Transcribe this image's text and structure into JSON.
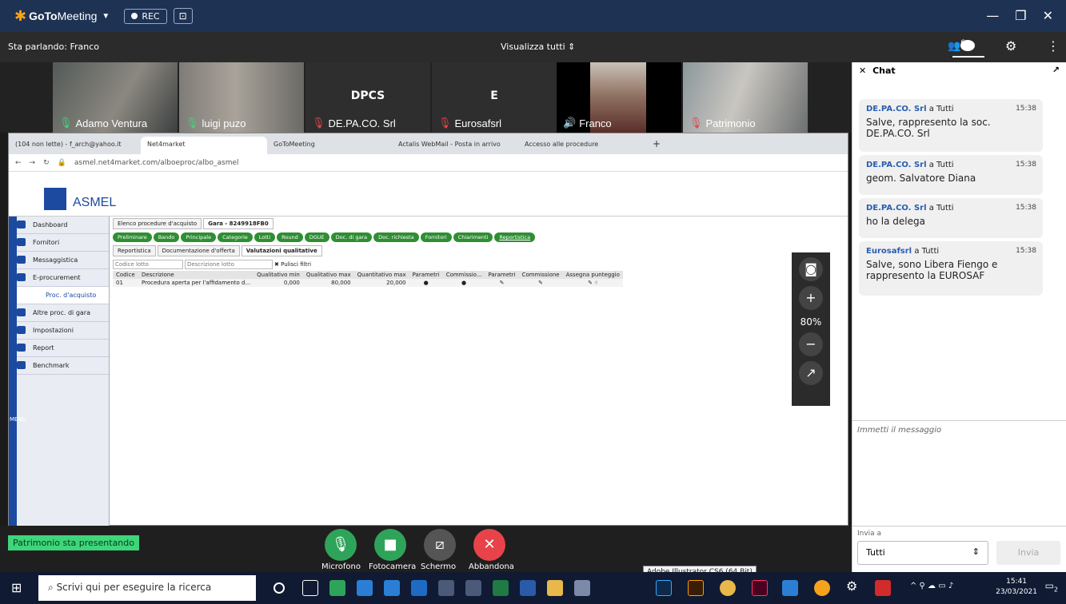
{
  "app": {
    "brand_go": "GoTo",
    "brand_rest": "Meeting",
    "rec_label": "REC",
    "speaking": "Sta parlando: Franco",
    "view_all": "Visualizza tutti",
    "attendee_count": "6"
  },
  "participants": [
    {
      "name": "Adamo Ventura",
      "mic": "on"
    },
    {
      "name": "luigi puzo",
      "mic": "on"
    },
    {
      "name": "DE.PA.CO. Srl",
      "initials": "DPCS",
      "mic": "off"
    },
    {
      "name": "Eurosafsrl",
      "initials": "E",
      "mic": "off"
    },
    {
      "name": "Franco",
      "mic": "speaking"
    },
    {
      "name": "Patrimonio",
      "mic": "off"
    }
  ],
  "browser": {
    "tabs": [
      "(104 non lette) - f_arch@yahoo.it",
      "Net4market",
      "GoToMeeting",
      "Actalis WebMail - Posta in arrivo",
      "Accesso alle procedure"
    ],
    "url": "asmel.net4market.com/alboeproc/albo_asmel",
    "site_name": "ASMEL",
    "sidebar": [
      "Dashboard",
      "Fornitori",
      "Messaggistica",
      "E-procurement",
      "Proc. d'acquisto",
      "Altre proc. di gara",
      "Impostazioni",
      "Report",
      "Benchmark"
    ],
    "menu_label": "MENU",
    "top_tabs": [
      "Elenco procedure d'acquisto",
      "Gara - 8249918FB0"
    ],
    "steps": [
      "Preliminare",
      "Bando",
      "Principale",
      "Categorie",
      "Lotti",
      "Round",
      "DGUE",
      "Doc. di gara",
      "Doc. richiesta",
      "Fornitori",
      "Chiarimenti",
      "Reportistica"
    ],
    "sub_tabs": [
      "Reportistica",
      "Documentazione d'offerta",
      "Valutazioni qualitative"
    ],
    "filter": {
      "lotto": "Codice lotto",
      "descr": "Descrizione lotto",
      "clear": "Pulisci filtri"
    },
    "columns": [
      "Codice",
      "Descrizione",
      "Qualitativo min",
      "Qualitativo max",
      "Quantitativo max",
      "Parametri",
      "Commissio...",
      "Parametri",
      "Commissione",
      "Assegna punteggio"
    ],
    "row": {
      "code": "01",
      "descr": "Procedura aperta per l'affidamento d...",
      "qmin": "0,000",
      "qmax": "80,000",
      "quant": "20,000"
    }
  },
  "zoom": {
    "level": "80%"
  },
  "bottom": {
    "presenting": "Patrimonio sta presentando",
    "mic": "Microfono",
    "camera": "Fotocamera",
    "screen": "Schermo",
    "leave": "Abbandona",
    "tooltip": "Adobe Illustrator CS6 (64 Bit)"
  },
  "chat": {
    "title": "Chat",
    "messages": [
      {
        "from": "DE.PA.CO. Srl",
        "to": "a Tutti",
        "time": "15:38",
        "text": "Salve, rappresento la soc. DE.PA.CO. Srl"
      },
      {
        "from": "DE.PA.CO. Srl",
        "to": "a Tutti",
        "time": "15:38",
        "text": "geom. Salvatore Diana"
      },
      {
        "from": "DE.PA.CO. Srl",
        "to": "a Tutti",
        "time": "15:38",
        "text": "ho la delega"
      },
      {
        "from": "Eurosafsrl",
        "to": "a Tutti",
        "time": "15:38",
        "text": "Salve, sono Libera Fiengo e rappresento la EUROSAF"
      }
    ],
    "placeholder": "Immetti il messaggio",
    "send_to_label": "Invia a",
    "send_to": "Tutti",
    "send": "Invia"
  },
  "taskbar": {
    "search": "Scrivi qui per eseguire la ricerca",
    "time": "15:41",
    "date": "23/03/2021",
    "notif": "2"
  },
  "colors": {
    "titlebar": "#1e3354",
    "green": "#3dd67a",
    "red": "#e8434a",
    "brand": "#1c4aa0"
  }
}
